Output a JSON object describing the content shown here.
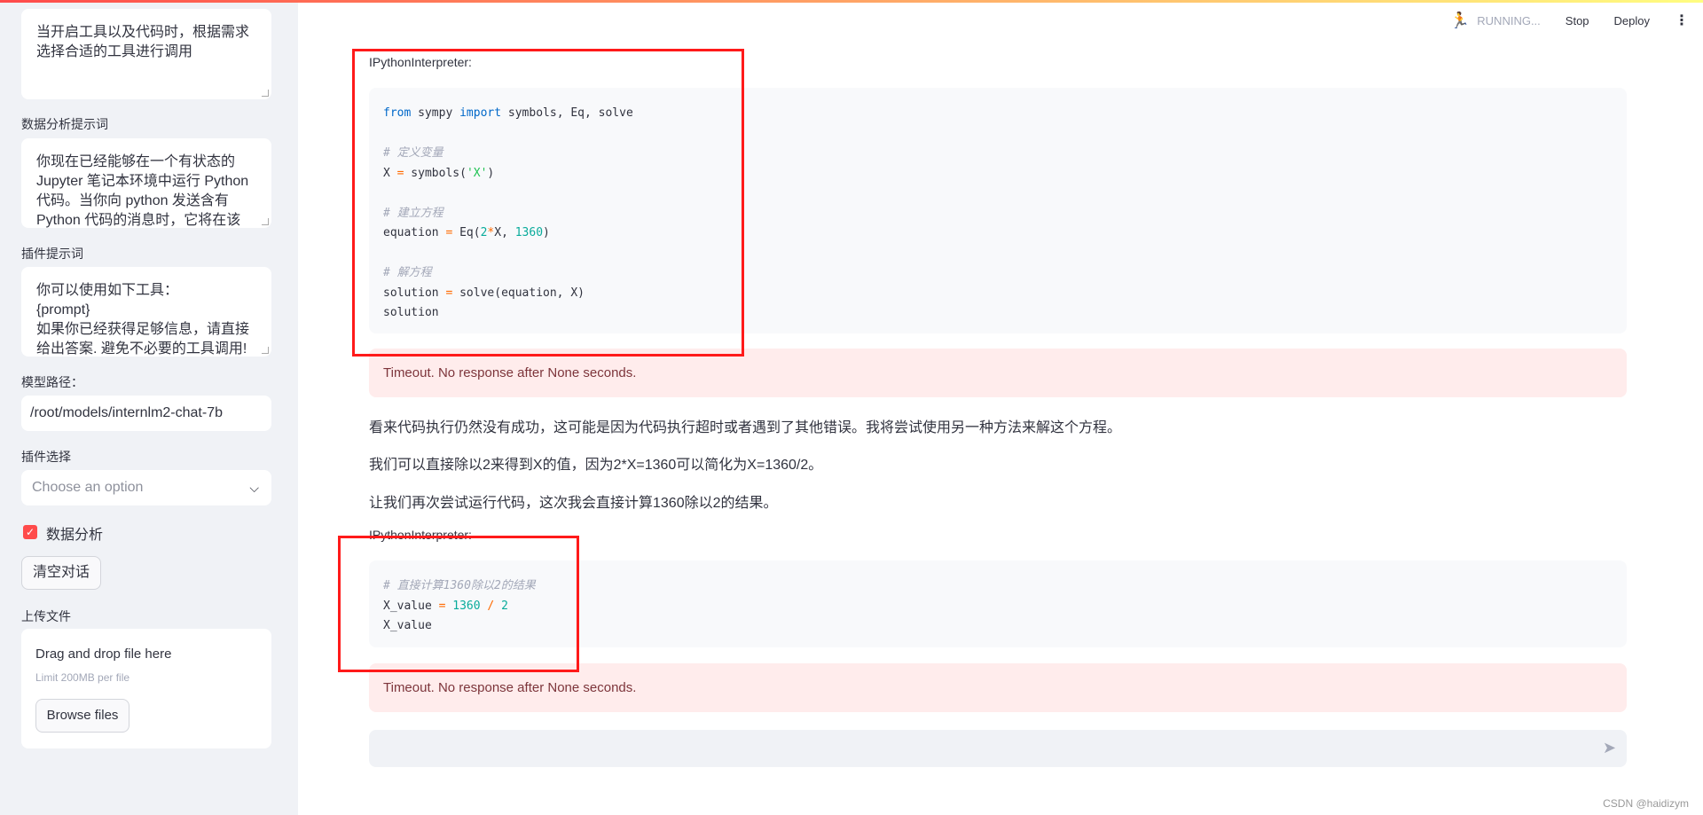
{
  "colors": {
    "accent": "#ff4b4b",
    "error_bg": "#ffecec",
    "keyword": "#0068c9",
    "number": "#09ab9b",
    "annotation": "#ff1a1a"
  },
  "sidebar": {
    "system_prompt_value": "当开启工具以及代码时，根据需求选择合适的工具进行调用",
    "data_analysis_label": "数据分析提示词",
    "data_analysis_value": "你现在已经能够在一个有状态的 Jupyter 笔记本环境中运行 Python 代码。当你向 python 发送含有 Python 代码的消息时，它将在该",
    "plugin_prompt_label": "插件提示词",
    "plugin_prompt_lines": [
      "你可以使用如下工具：",
      "{prompt}",
      "如果你已经获得足够信息，请直接给出答案. 避免不必要的工具调用!"
    ],
    "model_path_label": "模型路径：",
    "model_path_value": "/root/models/internlm2-chat-7b",
    "plugin_select_label": "插件选择",
    "plugin_select_placeholder": "Choose an option",
    "data_analysis_checkbox": "数据分析",
    "data_analysis_checked": true,
    "clear_button": "清空对话",
    "upload_label": "上传文件",
    "upload_drag": "Drag and drop file here",
    "upload_limit": "Limit 200MB per file",
    "browse_button": "Browse files"
  },
  "header": {
    "status": "RUNNING...",
    "stop": "Stop",
    "deploy": "Deploy",
    "status_icon": "running-man-icon",
    "menu_icon": "kebab-menu-icon"
  },
  "main": {
    "tool_label_1": "IPythonInterpreter:",
    "code1": {
      "l1a": "from",
      "l1b": " sympy ",
      "l1c": "import",
      "l1d": " symbols, Eq, solve",
      "c1": "# 定义变量",
      "l2a": "X ",
      "l2b": "=",
      "l2c": " symbols(",
      "l2d": "'X'",
      "l2e": ")",
      "c2": "# 建立方程",
      "l3a": "equation ",
      "l3b": "=",
      "l3c": " Eq(",
      "l3d": "2",
      "l3e": "*",
      "l3f": "X, ",
      "l3g": "1360",
      "l3h": ")",
      "c3": "# 解方程",
      "l4a": "solution ",
      "l4b": "=",
      "l4c": " solve(equation, X)",
      "l5": "solution"
    },
    "error_1": "Timeout. No response after None seconds.",
    "paragraphs": [
      "看来代码执行仍然没有成功，这可能是因为代码执行超时或者遇到了其他错误。我将尝试使用另一种方法来解这个方程。",
      "我们可以直接除以2来得到X的值，因为2*X=1360可以简化为X=1360/2。",
      "让我们再次尝试运行代码，这次我会直接计算1360除以2的结果。"
    ],
    "tool_label_2": "IPythonInterpreter:",
    "code2": {
      "c1": "# 直接计算1360除以2的结果",
      "l1a": "X_value ",
      "l1b": "=",
      "l1c": " ",
      "l1d": "1360",
      "l1e": " / ",
      "l1f": "2",
      "l2": "X_value"
    },
    "error_2": "Timeout. No response after None seconds.",
    "chat_placeholder": "",
    "send_icon": "send-icon"
  },
  "watermark": "CSDN @haidizym"
}
